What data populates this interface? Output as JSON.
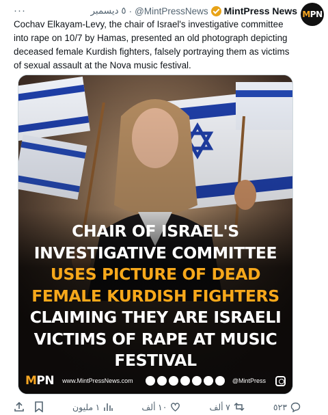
{
  "tweet": {
    "author_name": "MintPress News",
    "handle": "@MintPressNews",
    "separator": "·",
    "date": "٥ ديسمبر",
    "more_label": "···",
    "text": "Cochav Elkayam-Levy, the chair of Israel's investigative committee into rape on 10/7 by Hamas, presented an old photograph depicting deceased female Kurdish fighters, falsely portraying them as victims of sexual assault at the Nova music festival.",
    "verified_color": "#e8a317",
    "avatar_icon": "mintpress-logo-icon"
  },
  "media": {
    "caption_lines": [
      {
        "text": "CHAIR OF ISRAEL'S",
        "color": "white"
      },
      {
        "text": "INVESTIGATIVE COMMITTEE",
        "color": "white"
      },
      {
        "text": "USES PICTURE OF DEAD",
        "color": "yellow"
      },
      {
        "text": "FEMALE KURDISH FIGHTERS",
        "color": "yellow"
      },
      {
        "text": "CLAIMING THEY ARE ISRAELI",
        "color": "white"
      },
      {
        "text": "VICTIMS OF RAPE AT MUSIC",
        "color": "white"
      },
      {
        "text": "FESTIVAL",
        "color": "white"
      }
    ],
    "accent_color": "#f7a81b",
    "footer_logo_mi": "M",
    "footer_logo_pn": "PN",
    "footer_site": "www.MintPressNews.com",
    "footer_handle": "@MintPress",
    "social_icons": [
      "mint-icon",
      "rumble-icon",
      "share-icon",
      "telegram-icon",
      "youtube-icon",
      "tiktok-icon",
      "twitter-icon"
    ]
  },
  "actions": {
    "replies": "٥٢٣",
    "retweets": "٧ ألف",
    "likes": "١٠ ألف",
    "views": "١ مليون"
  }
}
